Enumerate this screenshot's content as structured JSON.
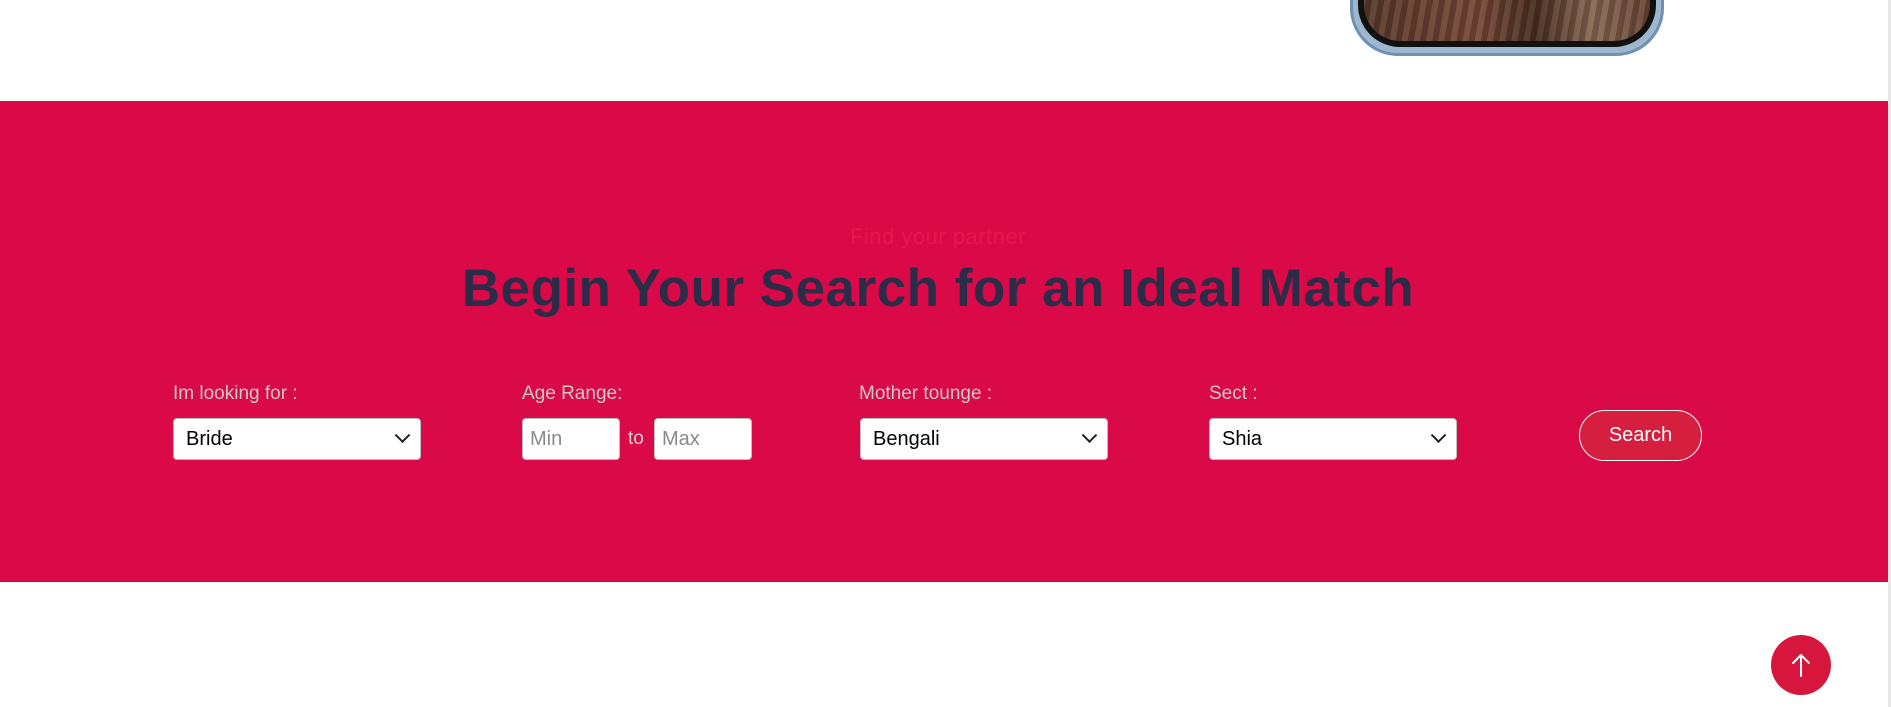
{
  "search_section": {
    "eyebrow": "Find your partner",
    "headline": "Begin Your Search for an Ideal Match",
    "background_color": "#d90a47",
    "headline_color": "#2c2c48"
  },
  "looking_for": {
    "label": "Im looking for :",
    "selected": "Bride"
  },
  "age_range": {
    "label": "Age Range:",
    "min_placeholder": "Min",
    "separator": "to",
    "max_placeholder": "Max"
  },
  "mother_tongue": {
    "label": "Mother tounge :",
    "selected": "Bengali"
  },
  "sect": {
    "label": "Sect :",
    "selected": "Shia"
  },
  "search_button": {
    "label": "Search"
  },
  "scroll_top": {
    "icon": "arrow-up-icon"
  }
}
